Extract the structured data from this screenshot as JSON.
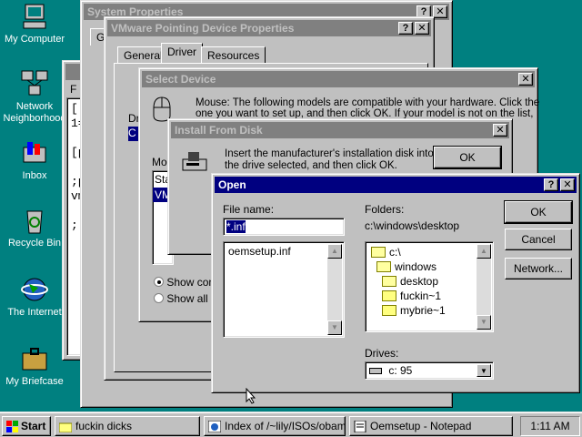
{
  "desktop": {
    "icons": [
      {
        "label": "My Computer",
        "icon": "my-computer-icon"
      },
      {
        "label": "Network\nNeighborhood",
        "icon": "network-neighborhood-icon"
      },
      {
        "label": "Inbox",
        "icon": "inbox-icon"
      },
      {
        "label": "Recycle Bin",
        "icon": "recycle-bin-icon"
      },
      {
        "label": "The Internet",
        "icon": "internet-icon"
      },
      {
        "label": "My Briefcase",
        "icon": "briefcase-icon"
      }
    ]
  },
  "notepad": {
    "lines": [
      "[",
      "1=",
      "",
      "[p",
      "",
      ";p",
      "vm",
      "",
      ";"
    ]
  },
  "system_properties": {
    "title": "System Properties",
    "tab_partial": "Ge"
  },
  "vmware_props": {
    "title": "VMware Pointing Device Properties",
    "tabs": [
      "General",
      "Driver",
      "Resources"
    ],
    "partial_labels": [
      "Dr",
      "C",
      "Mod",
      "Sta",
      "VM"
    ],
    "radio_show_compatible": "Show com",
    "radio_show_all": "Show all d"
  },
  "select_device": {
    "title": "Select Device",
    "text_line1": "Mouse: The following models are compatible with your hardware. Click the",
    "text_line2": "one you want to set up, and then click OK. If your model is not on the list,"
  },
  "install_from_disk": {
    "title": "Install From Disk",
    "text": "Insert the manufacturer's installation disk into the drive selected, and then click OK.",
    "ok_label": "OK"
  },
  "open_dialog": {
    "title": "Open",
    "file_name_label": "File name:",
    "file_name_value": "*.inf",
    "files": [
      "oemsetup.inf"
    ],
    "folders_label": "Folders:",
    "current_path": "c:\\windows\\desktop",
    "folder_tree": [
      {
        "name": "c:\\",
        "level": 0
      },
      {
        "name": "windows",
        "level": 1
      },
      {
        "name": "desktop",
        "level": 2
      },
      {
        "name": "fuckin~1",
        "level": 3
      },
      {
        "name": "mybrie~1",
        "level": 3
      }
    ],
    "drives_label": "Drives:",
    "drive_value": "c: 95",
    "ok_label": "OK",
    "cancel_label": "Cancel",
    "network_label": "Network..."
  },
  "taskbar": {
    "start_label": "Start",
    "tasks": [
      {
        "label": "fuckin dicks",
        "icon": "folder-icon"
      },
      {
        "label": "Index of /~lily/ISOs/obam...",
        "icon": "browser-icon"
      },
      {
        "label": "Oemsetup - Notepad",
        "icon": "notepad-icon"
      }
    ],
    "clock": "1:11 AM"
  },
  "colors": {
    "desktop": "#008080",
    "active_title": "#000080",
    "inactive_title": "#808080",
    "face": "#c0c0c0"
  }
}
